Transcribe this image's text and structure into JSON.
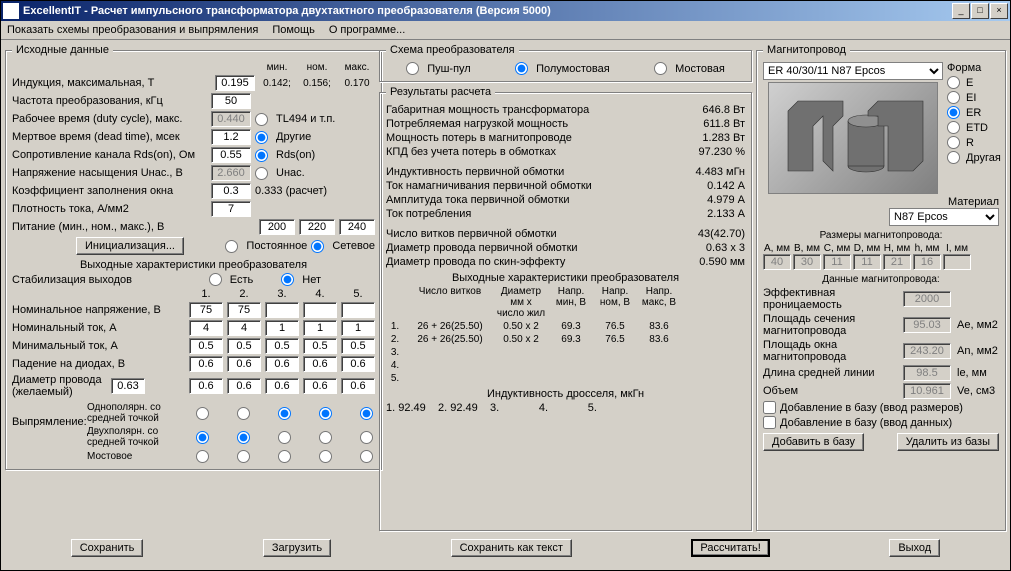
{
  "window": {
    "title": "ExcellentIT - Расчет импульсного трансформатора двухтактного преобразователя (Версия 5000)"
  },
  "menu": {
    "m1": "Показать схемы преобразования и выпрямления",
    "m2": "Помощь",
    "m3": "О программе..."
  },
  "src": {
    "legend": "Исходные данные",
    "hdr": {
      "min": "мин.",
      "nom": "ном.",
      "max": "макс."
    },
    "induction": {
      "label": "Индукция, максимальная, Т",
      "val": "0.195",
      "min": "0.142;",
      "nom": "0.156;",
      "max": "0.170"
    },
    "freq": {
      "label": "Частота преобразования, кГц",
      "val": "50"
    },
    "duty": {
      "label": "Рабочее время (duty cycle), макс.",
      "val": "0.440"
    },
    "dead": {
      "label": "Мертвое время (dead time), мсек",
      "val": "1.2"
    },
    "rds": {
      "label": "Сопротивление канала Rds(on), Ом",
      "val": "0.55"
    },
    "usat": {
      "label": "Напряжение насыщения Uнас., В",
      "val": "2.660"
    },
    "kfill": {
      "label": "Коэффициент заполнения окна",
      "val": "0.3",
      "calc": "0.333 (расчет)"
    },
    "jdens": {
      "label": "Плотность тока, А/мм2",
      "val": "7"
    },
    "supply": {
      "label": "Питание (мин., ном., макс.), В",
      "v1": "200",
      "v2": "220",
      "v3": "240"
    },
    "initbtn": "Инициализация...",
    "radio_tl": "TL494 и т.п.",
    "radio_other": "Другие",
    "radio_rdson": "Rds(on)",
    "radio_unas": "Uнас.",
    "radio_const": "Постоянное",
    "radio_net": "Сетевое",
    "outchar": "Выходные характеристики преобразователя",
    "stab": "Стабилизация выходов",
    "stab_yes": "Есть",
    "stab_no": "Нет",
    "colhdr": {
      "c1": "1.",
      "c2": "2.",
      "c3": "3.",
      "c4": "4.",
      "c5": "5."
    },
    "nomV": {
      "label": "Номинальное напряжение, В",
      "v": [
        "75",
        "75",
        "",
        "",
        ""
      ]
    },
    "nomI": {
      "label": "Номинальный ток, А",
      "v": [
        "4",
        "4",
        "1",
        "1",
        "1"
      ]
    },
    "minI": {
      "label": "Минимальный ток, А",
      "v": [
        "0.5",
        "0.5",
        "0.5",
        "0.5",
        "0.5"
      ]
    },
    "drop": {
      "label": "Падение на диодах, В",
      "v": [
        "0.6",
        "0.6",
        "0.6",
        "0.6",
        "0.6"
      ]
    },
    "diam": {
      "label": "Диаметр провода (желаемый)",
      "val": "0.63",
      "v": [
        "0.6",
        "0.6",
        "0.6",
        "0.6",
        "0.6"
      ]
    },
    "rect": {
      "label": "Выпрямление:",
      "r1": "Однополярн. со средней точкой",
      "r2": "Двухполярн. со средней точкой",
      "r3": "Мостовое"
    }
  },
  "scheme": {
    "legend": "Схема преобразователя",
    "r1": "Пуш-пул",
    "r2": "Полумостовая",
    "r3": "Мостовая"
  },
  "res": {
    "legend": "Результаты расчета",
    "p_gab": {
      "l": "Габаритная мощность трансформатора",
      "v": "646.8 Вт"
    },
    "p_load": {
      "l": "Потребляемая нагрузкой мощность",
      "v": "611.8 Вт"
    },
    "p_loss": {
      "l": "Мощность потерь в магнитопроводе",
      "v": "1.283 Вт"
    },
    "eff": {
      "l": "КПД без учета потерь в обмотках",
      "v": "97.230 %"
    },
    "L1": {
      "l": "Индуктивность первичной обмотки",
      "v": "4.483 мГн"
    },
    "Imag": {
      "l": "Ток намагничивания первичной обмотки",
      "v": "0.142 А"
    },
    "Iamp": {
      "l": "Амплитуда тока первичной обмотки",
      "v": "4.979 А"
    },
    "Icons": {
      "l": "Ток потребления",
      "v": "2.133 А"
    },
    "N1": {
      "l": "Число витков первичной обмотки",
      "v": "43(42.70)"
    },
    "d1": {
      "l": "Диаметр провода первичной обмотки",
      "v": "0.63 x 3"
    },
    "dsk": {
      "l": "Диаметр провода по скин-эффекту",
      "v": "0.590 мм"
    },
    "outhdr": "Выходные характеристики преобразователя",
    "th": {
      "n": "Число витков",
      "d": "Диаметр мм х число жил",
      "vmin": "Напр. мин, В",
      "vnom": "Напр. ном, В",
      "vmax": "Напр. макс, В"
    },
    "rows": [
      {
        "i": "1.",
        "n": "26 + 26(25.50)",
        "d": "0.50 x 2",
        "vmin": "69.3",
        "vnom": "76.5",
        "vmax": "83.6"
      },
      {
        "i": "2.",
        "n": "26 + 26(25.50)",
        "d": "0.50 x 2",
        "vmin": "69.3",
        "vnom": "76.5",
        "vmax": "83.6"
      },
      {
        "i": "3.",
        "n": "",
        "d": "",
        "vmin": "",
        "vnom": "",
        "vmax": ""
      },
      {
        "i": "4.",
        "n": "",
        "d": "",
        "vmin": "",
        "vnom": "",
        "vmax": ""
      },
      {
        "i": "5.",
        "n": "",
        "d": "",
        "vmin": "",
        "vnom": "",
        "vmax": ""
      }
    ],
    "choke": "Индуктивность дросселя, мкГн",
    "chokerow": "1. 92.49    2. 92.49    3.             4.             5."
  },
  "core": {
    "legend": "Магнитопровод",
    "select": "ER 40/30/11 N87 Epcos",
    "shape": "Форма",
    "shapes": {
      "E": "E",
      "EI": "EI",
      "ER": "ER",
      "ETD": "ETD",
      "R": "R",
      "other": "Другая"
    },
    "material": "Материал",
    "matval": "N87 Epcos",
    "dimshdr": "Размеры магнитопровода:",
    "dimlbl": {
      "A": "A, мм",
      "B": "B, мм",
      "C": "C, мм",
      "D": "D, мм",
      "H": "H, мм",
      "h": "h, мм",
      "I": "I, мм"
    },
    "dims": {
      "A": "40",
      "B": "30",
      "C": "11",
      "D": "11",
      "H": "21",
      "h": "16",
      "I": ""
    },
    "datahdr": "Данные магнитопровода:",
    "mu": {
      "l": "Эффективная проницаемость",
      "v": "2000"
    },
    "Ae": {
      "l": "Площадь сечения магнитопровода",
      "v": "95.03",
      "u": "Ae, мм2"
    },
    "An": {
      "l": "Площадь окна магнитопровода",
      "v": "243.20",
      "u": "An, мм2"
    },
    "le": {
      "l": "Длина средней линии",
      "v": "98.5",
      "u": "le, мм"
    },
    "Ve": {
      "l": "Объем",
      "v": "10.961",
      "u": "Ve, см3"
    },
    "add1": "Добавление в базу (ввод размеров)",
    "add2": "Добавление в базу (ввод данных)",
    "addbtn": "Добавить в базу",
    "delbtn": "Удалить из базы"
  },
  "buttons": {
    "save": "Сохранить",
    "load": "Загрузить",
    "saveTxt": "Сохранить как текст",
    "calc": "Рассчитать!",
    "exit": "Выход"
  }
}
